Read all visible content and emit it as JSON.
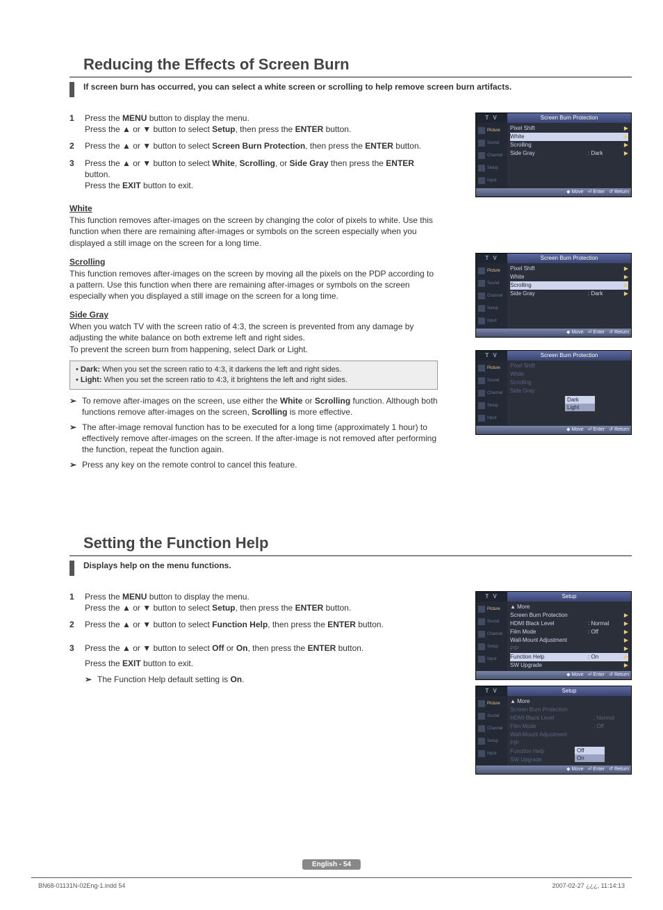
{
  "section1": {
    "title": "Reducing the Effects of Screen Burn",
    "intro": "If screen burn has occurred, you can select a white screen or scrolling to help remove screen burn artifacts.",
    "steps": [
      {
        "num": "1",
        "pre": "Press the ",
        "b1": "MENU",
        "mid1": " button to display the menu.",
        "br": true,
        "pre2": "Press the ▲ or ▼ button to select ",
        "b2": "Setup",
        "mid2": ", then press the ",
        "b3": "ENTER",
        "tail": " button."
      },
      {
        "num": "2",
        "pre": "Press the ▲ or ▼ button to select ",
        "b1": "Screen Burn Protection",
        "mid": ", then press the ",
        "b2": "ENTER",
        "tail": " button."
      },
      {
        "num": "3",
        "pre": "Press the ▲ or ▼ button to select ",
        "b1": "White",
        "c1": ", ",
        "b2": "Scrolling",
        "c2": ", or ",
        "b3": "Side Gray",
        "tail1": " then press the ",
        "b4": "ENTER",
        "tail2": " button.",
        "br": true,
        "line2a": "Press the ",
        "b5": "EXIT",
        "line2b": " button to exit."
      }
    ],
    "white_h": "White",
    "white_p": "This function removes after-images on the screen by changing the color of pixels to white. Use this function when there are remaining after-images or symbols on the screen especially when you displayed a still image on the screen for a long time.",
    "scroll_h": "Scrolling",
    "scroll_p": "This function removes after-images on the screen by moving all the pixels on the PDP according to a pattern. Use this function when there are remaining after-images or symbols on the screen especially when you displayed a still image on the screen for a long time.",
    "sidegray_h": "Side Gray",
    "sidegray_p1": "When you watch TV with the screen ratio of 4:3, the screen is prevented from any damage by adjusting the white balance on both extreme left and right sides.",
    "sidegray_p2": "To prevent the screen burn from happening, select Dark or Light.",
    "note_dark_b": "Dark:",
    "note_dark": " When you set the screen ratio to 4:3, it darkens the left and right sides.",
    "note_light_b": "Light:",
    "note_light": " When you set the screen ratio to 4:3, it brightens the left and right sides.",
    "arrows": [
      {
        "pre": "To remove after-images on the screen, use either the ",
        "b1": "White",
        "mid": " or ",
        "b2": "Scrolling",
        "post1": " function. Although both functions remove after-images on the screen, ",
        "b3": "Scrolling",
        "post2": " is more effective."
      },
      {
        "text": "The after-image removal function has to be executed for a long time (approximately 1 hour) to effectively remove after-images on the screen. If the after-image is not removed after performing the function, repeat the function again."
      },
      {
        "text": "Press any key on the remote control to cancel this feature."
      }
    ]
  },
  "section2": {
    "title": "Setting the Function Help",
    "intro": "Displays help on the menu functions.",
    "steps": [
      {
        "num": "1",
        "pre": "Press the ",
        "b1": "MENU",
        "mid1": " button to display the menu.",
        "br": true,
        "pre2": "Press the ▲ or ▼ button to select ",
        "b2": "Setup",
        "mid2": ", then press the ",
        "b3": "ENTER",
        "tail": " button."
      },
      {
        "num": "2",
        "pre": "Press the ▲ or ▼ button to select ",
        "b1": "Function Help",
        "mid": ", then press the ",
        "b2": "ENTER",
        "tail": " button."
      },
      {
        "num": "3",
        "pre": "Press the ▲ or ▼ button to select ",
        "b1": "Off",
        "c1": " or ",
        "b2": "On",
        "mid": ", then press the ",
        "b3": "ENTER",
        "tail": " button.",
        "extra1a": "Press the ",
        "extra1b": "EXIT",
        "extra1c": " button to exit.",
        "arrow_pre": "The Function Help default setting is ",
        "arrow_b": "On",
        "arrow_post": "."
      }
    ]
  },
  "osd": {
    "tv": "T V",
    "title_sbp": "Screen Burn Protection",
    "title_setup": "Setup",
    "side": [
      "Picture",
      "Sound",
      "Channel",
      "Setup",
      "Input"
    ],
    "rows_sbp": [
      "Pixel Shift",
      "White",
      "Scrolling",
      "Side Gray"
    ],
    "val_dark": ": Dark",
    "drop": [
      "Dark",
      "Light"
    ],
    "setup_rows_top": "▲ More",
    "setup_rows": [
      "Screen Burn Protection",
      "HDMI Black Level",
      "Film Mode",
      "Wall-Mount Adjustment",
      "PIP",
      "Function Help",
      "SW Upgrade"
    ],
    "setup_vals": {
      "hdmi": ": Normal",
      "film": ": Off",
      "fh_on": ": On"
    },
    "fh_opts": [
      "Off",
      "On"
    ],
    "foot": {
      "move": "Move",
      "enter": "Enter",
      "ret": "Return"
    }
  },
  "footer": {
    "page": "English - 54",
    "left": "BN68-01131N-02Eng-1.indd   54",
    "right": "2007-02-27   ¿¿¿, 11:14:13"
  },
  "glyph": {
    "arrow": "➢",
    "tri": "▶",
    "updown": "◆",
    "ret": "↺",
    "ent": "⏎"
  }
}
